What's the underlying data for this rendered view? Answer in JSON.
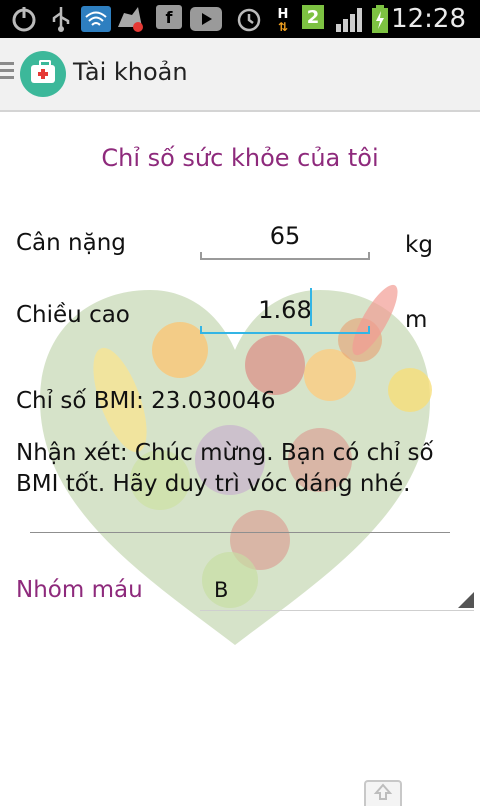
{
  "status_bar": {
    "time": "12:28",
    "network_badge": "H",
    "sim_badge": "2",
    "icons": [
      "power-icon",
      "usb-icon",
      "wifi-icon",
      "app-update-icon",
      "facebook-icon",
      "youtube-icon",
      "alarm-icon",
      "signal-icon",
      "battery-charging-icon"
    ]
  },
  "action_bar": {
    "title": "Tài khoản",
    "app_icon": "medical-kit-icon",
    "app_icon_color": "#3cb89a"
  },
  "health": {
    "title": "Chỉ số sức khỏe của tôi",
    "weight": {
      "label": "Cân nặng",
      "value": "65",
      "unit": "kg"
    },
    "height": {
      "label": "Chiều cao",
      "value": "1.68",
      "unit": "m"
    },
    "bmi_text": "Chỉ số BMI: 23.030046",
    "comment": "Nhận xét: Chúc mừng. Bạn có chỉ số BMI tốt. Hãy duy trì vóc dáng nhé.",
    "blood_group": {
      "label": "Nhóm máu",
      "value": "B"
    }
  },
  "colors": {
    "accent_purple": "#8e2a7c",
    "focus_blue": "#33b5e5"
  }
}
